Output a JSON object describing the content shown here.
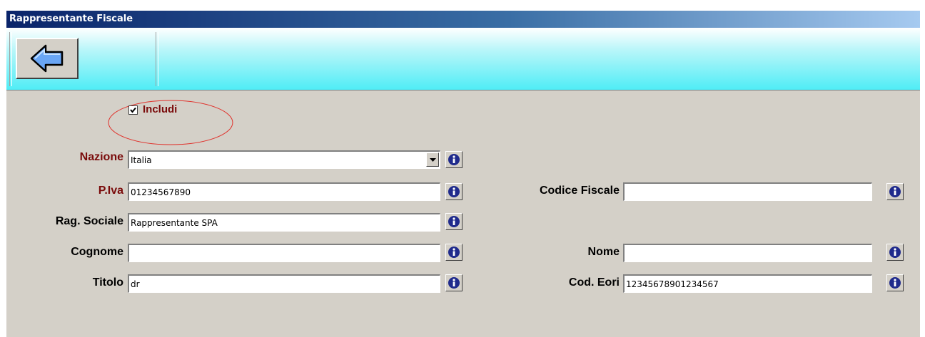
{
  "window": {
    "title": "Rappresentante Fiscale"
  },
  "toolbar": {
    "back_icon": "left-arrow-icon"
  },
  "includi": {
    "label": "Includi",
    "checked": true
  },
  "form": {
    "nazione": {
      "label": "Nazione",
      "value": "Italia"
    },
    "piva": {
      "label": "P.Iva",
      "value": "01234567890"
    },
    "rag_sociale": {
      "label": "Rag. Sociale",
      "value": "Rappresentante SPA"
    },
    "cognome": {
      "label": "Cognome",
      "value": ""
    },
    "titolo": {
      "label": "Titolo",
      "value": "dr"
    },
    "codice_fiscale": {
      "label": "Codice Fiscale",
      "value": ""
    },
    "nome": {
      "label": "Nome",
      "value": ""
    },
    "cod_eori": {
      "label": "Cod. Eori",
      "value": "12345678901234567"
    }
  },
  "colors": {
    "required_label": "#7a0b0b",
    "info_icon": "#1f2a8c",
    "toolbar_accent": "#4fedf6"
  }
}
